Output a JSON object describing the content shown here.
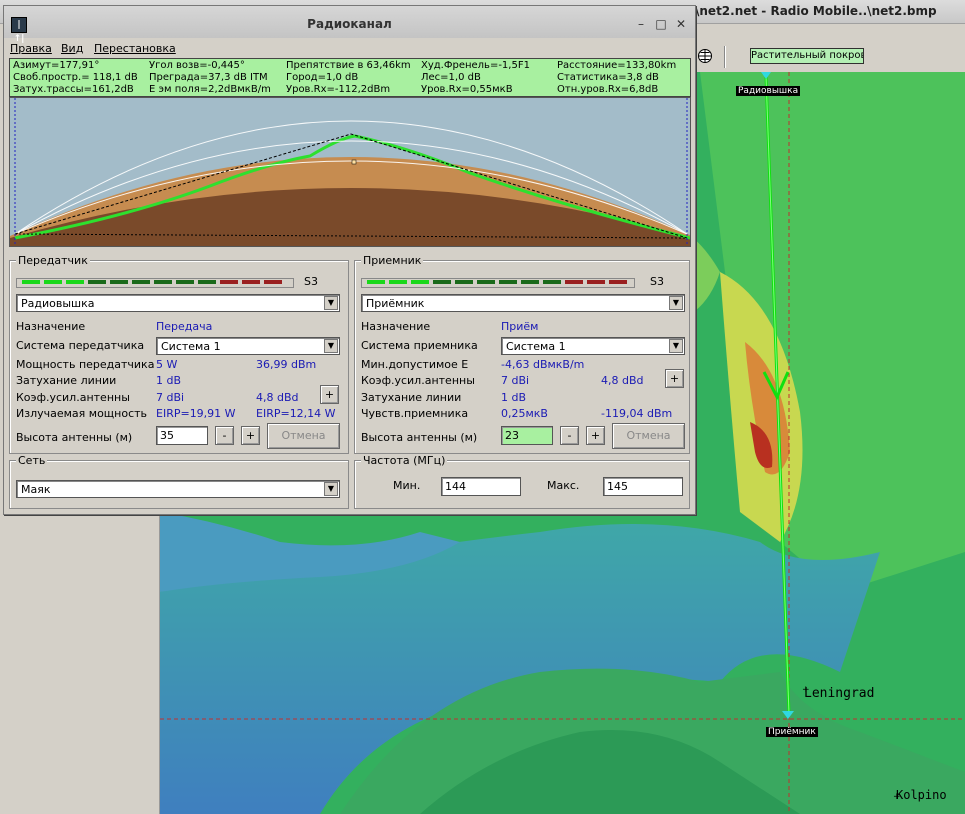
{
  "app": {
    "title": "\\net2.net - Radio Mobile..\\net2.bmp",
    "vegetation_button": "Растительный покров",
    "map": {
      "labels": {
        "transmitter": "Радиовышка",
        "receiver": "Приёмник",
        "city1": "Leningrad",
        "city2": "Kolpino"
      }
    }
  },
  "dialog": {
    "title": "Радиоканал",
    "menu": [
      "Правка",
      "Вид",
      "Перестановка"
    ],
    "stats": [
      [
        "Азимут=177,91°",
        "Угол возв=-0,445°",
        "Препятствие в 63,46km",
        "Худ.Френель=-1,5F1",
        "Расстояние=133,80km"
      ],
      [
        "Своб.простр.= 118,1 dB",
        "Преграда=37,3 dB ITM",
        "Город=1,0 dB",
        "Лес=1,0 dB",
        "Статистика=3,8 dB"
      ],
      [
        "Затух.трассы=161,2dB",
        "Е эм поля=2,2dBмкВ/m",
        "Уров.Rx=-112,2dBm",
        "Уров.Rx=0,55мкВ",
        "Отн.уров.Rx=6,8dB"
      ]
    ],
    "transmitter": {
      "group_label": "Передатчик",
      "meter_label": "S3",
      "unit": "Радиовышка",
      "rows": {
        "purpose_label": "Назначение",
        "purpose_value": "Передача",
        "system_label": "Система передатчика",
        "system_value": "Система   1",
        "power_label": "Мощность передатчика",
        "power_w": "5 W",
        "power_dbm": "36,99 dBm",
        "loss_label": "Затухание линии",
        "loss_value": "1 dB",
        "gain_label": "Коэф.усил.антенны",
        "gain_dbi": "7 dBi",
        "gain_dbd": "4,8 dBd",
        "erp_label": "Излучаемая мощность",
        "eirp": "EIRP=19,91 W",
        "erp": "EIRP=12,14 W",
        "height_label": "Высота антенны (м)",
        "height_value": "35"
      },
      "plus": "+",
      "minus": "-",
      "cancel": "Отмена"
    },
    "receiver": {
      "group_label": "Приемник",
      "meter_label": "S3",
      "unit": "Приёмник",
      "rows": {
        "purpose_label": "Назначение",
        "purpose_value": "Приём",
        "system_label": "Система приемника",
        "system_value": "Система   1",
        "min_label": "Мин.допустимое Е",
        "min_value": "-4,63 dBмкВ/m",
        "gain_label": "Коэф.усил.антенны",
        "gain_dbi": "7 dBi",
        "gain_dbd": "4,8 dBd",
        "loss_label": "Затухание линии",
        "loss_value": "1 dB",
        "sens_label": "Чувств.приемника",
        "sens_uv": "0,25мкВ",
        "sens_dbm": "-119,04 dBm",
        "height_label": "Высота антенны (м)",
        "height_value": "23"
      },
      "plus": "+",
      "minus": "-",
      "cancel": "Отмена"
    },
    "network": {
      "group_label": "Сеть",
      "value": "Маяк"
    },
    "frequency": {
      "group_label": "Частота (МГц)",
      "min_label": "Мин.",
      "min_value": "144",
      "max_label": "Макс.",
      "max_value": "145"
    }
  },
  "colors": {
    "stats_bg": "#a8f0a0",
    "profile_sky": "#a3bcc9",
    "terrain": "#c68c50",
    "earth": "#7a4a2a",
    "path_line": "#1ad81a"
  }
}
